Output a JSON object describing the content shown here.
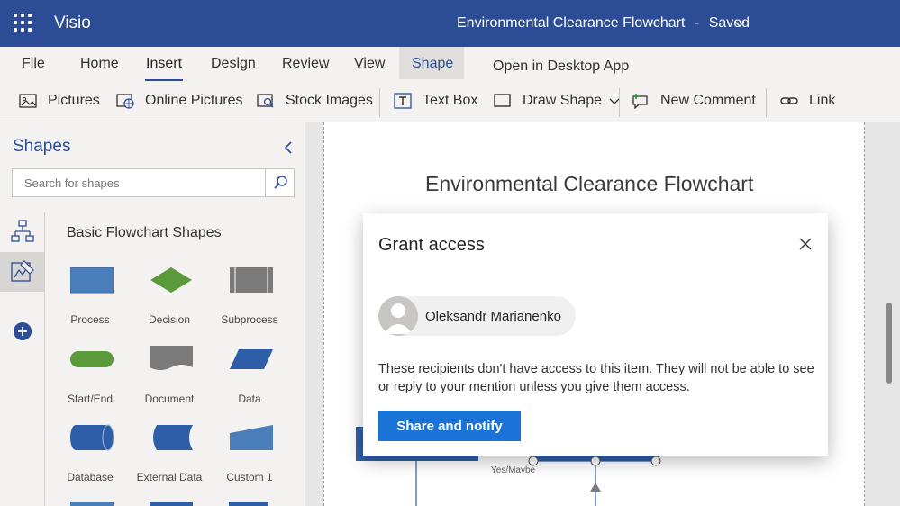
{
  "titlebar": {
    "app_name": "Visio",
    "document_title": "Environmental Clearance Flowchart",
    "separator": "-",
    "save_status": "Saved",
    "background_color": "#2c4d96"
  },
  "ribbon": {
    "tabs": [
      {
        "label": "File"
      },
      {
        "label": "Home"
      },
      {
        "label": "Insert",
        "active": true
      },
      {
        "label": "Design"
      },
      {
        "label": "Review"
      },
      {
        "label": "View"
      },
      {
        "label": "Shape",
        "highlighted": true
      },
      {
        "label": "Open in Desktop App"
      }
    ],
    "commands": [
      {
        "label": "Pictures",
        "icon": "picture-icon"
      },
      {
        "label": "Online Pictures",
        "icon": "online-picture-icon"
      },
      {
        "label": "Stock Images",
        "icon": "stock-images-icon"
      },
      {
        "label": "Text Box",
        "icon": "text-box-icon"
      },
      {
        "label": "Draw Shape",
        "icon": "draw-shape-icon"
      },
      {
        "label": "New Comment",
        "icon": "comment-icon"
      },
      {
        "label": "Link",
        "icon": "link-icon"
      }
    ]
  },
  "shapes_panel": {
    "title": "Shapes",
    "search_placeholder": "Search for shapes",
    "stencil_name": "Basic Flowchart Shapes",
    "shapes": [
      {
        "label": "Process",
        "color": "#4a7ebb"
      },
      {
        "label": "Decision",
        "color": "#5a9a3a"
      },
      {
        "label": "Subprocess",
        "color": "#7a7a7a"
      },
      {
        "label": "Start/End",
        "color": "#5a9a3a"
      },
      {
        "label": "Document",
        "color": "#7a7a7a"
      },
      {
        "label": "Data",
        "color": "#2f5ea8"
      },
      {
        "label": "Database",
        "color": "#2f5ea8"
      },
      {
        "label": "External Data",
        "color": "#2f5ea8"
      },
      {
        "label": "Custom 1",
        "color": "#4a7ebb"
      }
    ]
  },
  "canvas": {
    "diagram_title": "Environmental Clearance Flowchart",
    "connector_label": "Yes/Maybe"
  },
  "dialog": {
    "title": "Grant access",
    "recipient_name": "Oleksandr Marianenko",
    "message": "These recipients don't have access to this item. They will not be able to see or reply to your mention unless you give them access.",
    "primary_button": "Share and notify",
    "primary_color": "#1a73d6"
  }
}
